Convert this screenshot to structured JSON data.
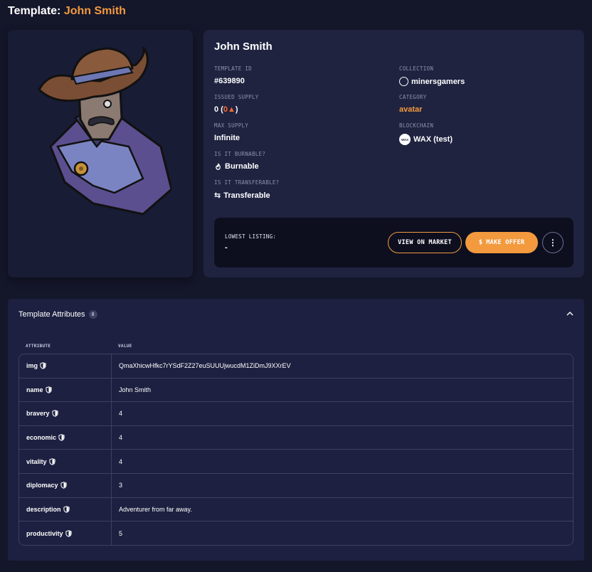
{
  "page": {
    "title_prefix": "Template:",
    "title_name": "John Smith"
  },
  "details": {
    "name": "John Smith",
    "template_id_label": "TEMPLATE ID",
    "template_id": "#639890",
    "collection_label": "COLLECTION",
    "collection": "minersgamers",
    "issued_supply_label": "ISSUED SUPPLY",
    "issued_supply": "0",
    "burned_count": "0",
    "category_label": "CATEGORY",
    "category": "avatar",
    "max_supply_label": "MAX SUPPLY",
    "max_supply": "Infinite",
    "blockchain_label": "BLOCKCHAIN",
    "blockchain": "WAX (test)",
    "blockchain_icon_text": "WAX",
    "burnable_label": "IS IT BURNABLE?",
    "burnable": "Burnable",
    "transferable_label": "IS IT TRANSFERABLE?",
    "transferable": "Transferable"
  },
  "listing": {
    "label": "LOWEST LISTING:",
    "value": "-",
    "view_market": "VIEW ON MARKET",
    "make_offer": "MAKE OFFER",
    "offer_icon": "$"
  },
  "attributes": {
    "title": "Template Attributes",
    "count": "8",
    "col_attribute": "ATTRIBUTE",
    "col_value": "VALUE",
    "rows": [
      {
        "name": "img",
        "value": "QmaXhicwHfkc7rYSdF2Z27euSUUUjwucdM1ZiDmJ9XXrEV"
      },
      {
        "name": "name",
        "value": "John Smith"
      },
      {
        "name": "bravery",
        "value": "4"
      },
      {
        "name": "economic",
        "value": "4"
      },
      {
        "name": "vitality",
        "value": "4"
      },
      {
        "name": "diplomacy",
        "value": "3"
      },
      {
        "name": "description",
        "value": "Adventurer from far away."
      },
      {
        "name": "productivity",
        "value": "5"
      }
    ]
  },
  "colors": {
    "accent": "#f39a3f",
    "background": "#14162a",
    "card": "#1f2340"
  }
}
